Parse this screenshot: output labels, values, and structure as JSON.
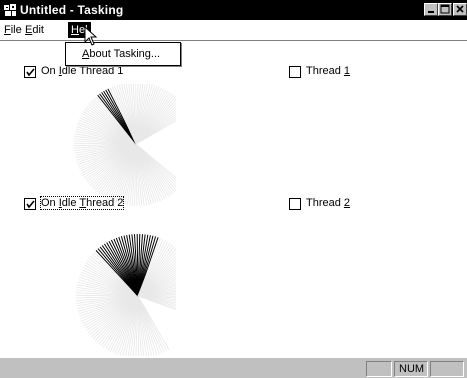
{
  "window": {
    "title": "Untitled - Tasking",
    "icon": "app-icon"
  },
  "menubar": {
    "items": [
      {
        "label_pre": "",
        "label_key": "F",
        "label_post": "ile"
      },
      {
        "label_pre": "",
        "label_key": "E",
        "label_post": "dit"
      },
      {
        "label_pre": "",
        "label_key": "H",
        "label_post": "el"
      }
    ]
  },
  "help_menu": {
    "items": [
      {
        "label_pre": "",
        "label_key": "A",
        "label_post": "bout Tasking..."
      }
    ]
  },
  "panels": [
    {
      "label_pre": "On ",
      "label_key": "I",
      "label_post": "dle Thread 1",
      "checked": true
    },
    {
      "label_pre": "Thread ",
      "label_key": "1",
      "label_post": "",
      "checked": false
    },
    {
      "label_pre": "On ",
      "label_key": "I",
      "label_post": "dle ",
      "label_key2": "T",
      "label_post2": "hread 2",
      "checked": true
    },
    {
      "label_pre": "Thread ",
      "label_key": "2",
      "label_post": "",
      "checked": false
    }
  ],
  "statusbar": {
    "num": "NUM"
  },
  "colors": {
    "titlebar": "#000000",
    "face": "#c0c0c0",
    "fan_light": "#e8e8e8",
    "fan_dark": "#000000"
  }
}
